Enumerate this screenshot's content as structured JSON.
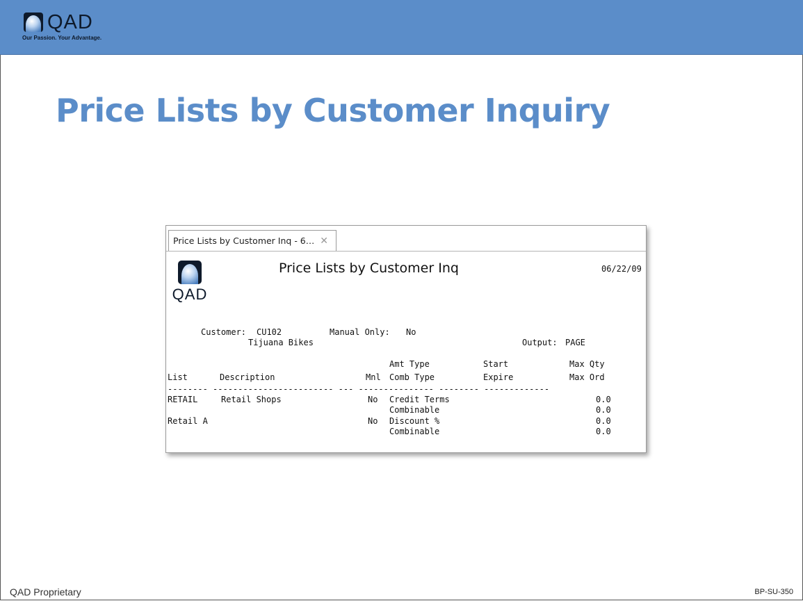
{
  "header": {
    "logo_text": "QAD",
    "tagline": "Our Passion. Your Advantage."
  },
  "slide": {
    "title": "Price Lists by Customer Inquiry",
    "footer_left": "QAD Proprietary",
    "footer_right": "BP-SU-350"
  },
  "window": {
    "tab_label": "Price Lists by Customer Inq - 6…",
    "tab_close": "✕",
    "report_logo_text": "QAD",
    "report_title": "Price Lists by Customer Inq",
    "report_date": "06/22/09",
    "customer_label": "Customer:",
    "customer_code": "CU102",
    "manual_only_label": "Manual Only:",
    "manual_only_value": "No",
    "customer_name": "Tijuana Bikes",
    "output_label": "Output:",
    "output_value": "PAGE",
    "columns": {
      "list": "List",
      "description": "Description",
      "mnl": "Mnl",
      "amt_type": "Amt Type",
      "comb_type": "Comb Type",
      "start": "Start",
      "expire": "Expire",
      "max_qty": "Max Qty",
      "max_ord": "Max Ord"
    },
    "rows": [
      {
        "list": "RETAIL",
        "description": "Retail Shops",
        "mnl": "No",
        "amt_type": "Credit Terms",
        "comb_type": "Combinable",
        "max_qty": "0.0",
        "max_ord": "0.0"
      },
      {
        "list": "Retail A",
        "description": "",
        "mnl": "No",
        "amt_type": "Discount %",
        "comb_type": "Combinable",
        "max_qty": "0.0",
        "max_ord": "0.0"
      }
    ]
  },
  "colors": {
    "header_blue": "#5b8dc9",
    "title_blue": "#5b8dc9",
    "logo_dark": "#0e1a2b"
  }
}
